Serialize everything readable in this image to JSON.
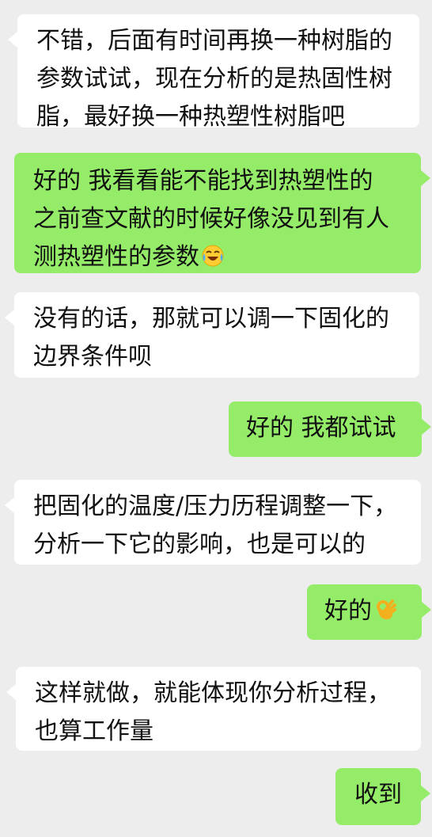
{
  "messages": [
    {
      "side": "left",
      "lines": [
        "不错，后面有时间再换一种树脂的",
        "参数试试，现在分析的是热固性树",
        "脂，最好换一种热塑性树脂吧"
      ]
    },
    {
      "side": "right",
      "lines": [
        "好的 我看看能不能找到热塑性的",
        "之前查文献的时候好像没见到有人",
        "测热塑性的参数"
      ],
      "emoji": "crying-laughing-emoji"
    },
    {
      "side": "left",
      "lines": [
        "没有的话，那就可以调一下固化的",
        "边界条件呗"
      ]
    },
    {
      "side": "right",
      "lines": [
        "好的 我都试试"
      ]
    },
    {
      "side": "left",
      "lines": [
        "把固化的温度/压力历程调整一下，",
        "分析一下它的影响，也是可以的"
      ]
    },
    {
      "side": "right",
      "lines": [
        "好的"
      ],
      "emoji": "ok-hand-emoji"
    },
    {
      "side": "left",
      "lines": [
        "这样就做，就能体现你分析过程，",
        "也算工作量"
      ]
    },
    {
      "side": "right",
      "lines": [
        "收到"
      ]
    }
  ],
  "colors": {
    "background": "#ededed",
    "incoming_bubble": "#ffffff",
    "outgoing_bubble": "#95ec69",
    "text": "#111111"
  }
}
